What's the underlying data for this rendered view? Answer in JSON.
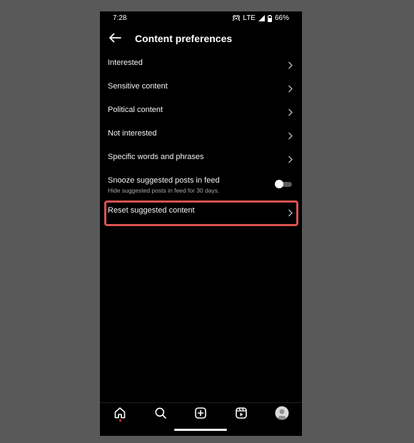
{
  "status_bar": {
    "time": "7:28",
    "network": "LTE",
    "battery": "66%"
  },
  "header": {
    "title": "Content preferences"
  },
  "items": [
    {
      "label": "Interested"
    },
    {
      "label": "Sensitive content"
    },
    {
      "label": "Political content"
    },
    {
      "label": "Not interested"
    },
    {
      "label": "Specific words and phrases"
    }
  ],
  "snooze": {
    "label": "Snooze suggested posts in feed",
    "sublabel": "Hide suggested posts in feed for 30 days.",
    "enabled": false
  },
  "reset": {
    "label": "Reset suggested content"
  },
  "bottom_nav": {
    "icons": [
      "home-icon",
      "search-icon",
      "create-icon",
      "reels-icon",
      "profile-icon"
    ]
  },
  "colors": {
    "background": "#000000",
    "highlight": "#d9534f",
    "notification_dot": "#ff3040"
  }
}
